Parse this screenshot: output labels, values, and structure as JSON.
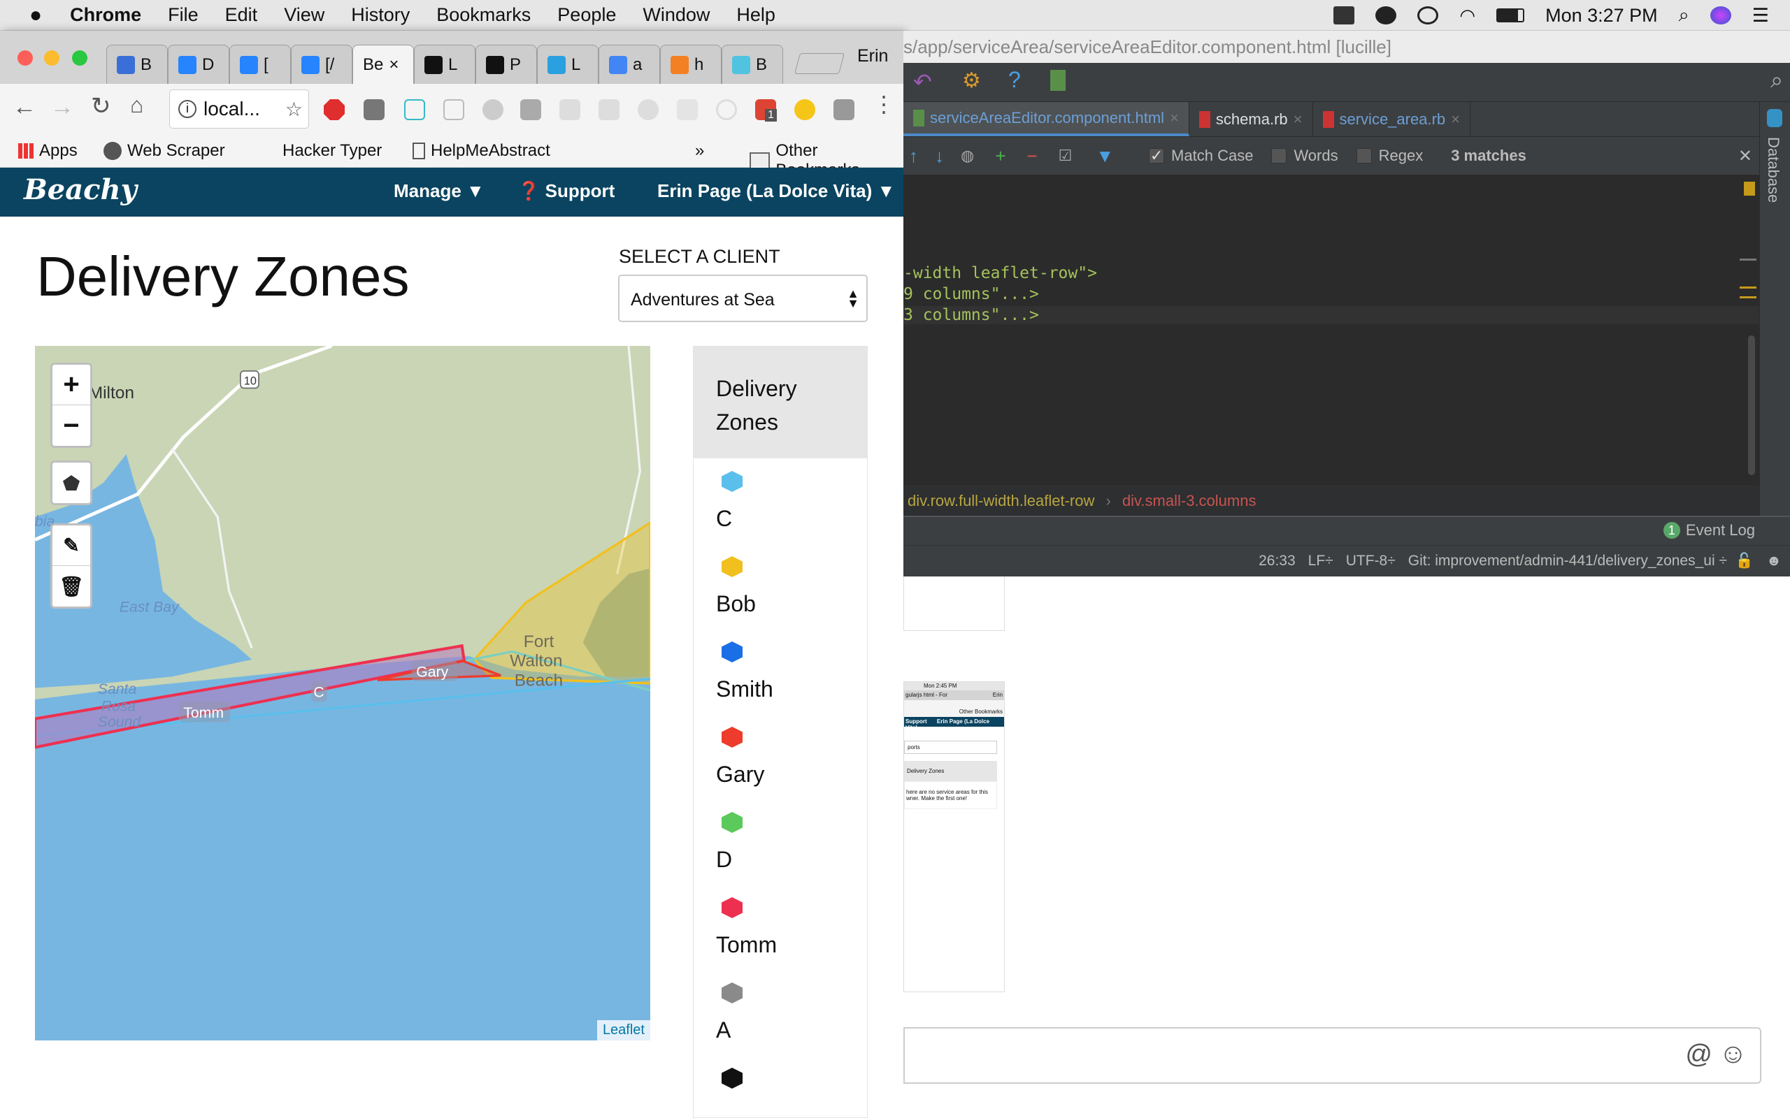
{
  "menubar": {
    "app": "Chrome",
    "items": [
      "File",
      "Edit",
      "View",
      "History",
      "Bookmarks",
      "People",
      "Window",
      "Help"
    ],
    "clock": "Mon 3:27 PM"
  },
  "chrome": {
    "tabs": [
      {
        "label": "B",
        "color": "#3a6fd8"
      },
      {
        "label": "D",
        "color": "#2684ff"
      },
      {
        "label": "[",
        "color": "#2684ff"
      },
      {
        "label": "[/",
        "color": "#2684ff"
      },
      {
        "label": "Be",
        "color": "#ffffff",
        "active": true
      },
      {
        "label": "L",
        "color": "#111111"
      },
      {
        "label": "P",
        "color": "#111111"
      },
      {
        "label": "L",
        "color": "#2aa0e0"
      },
      {
        "label": "a",
        "color": "#4285f4"
      },
      {
        "label": "h",
        "color": "#f48024"
      },
      {
        "label": "B",
        "color": "#4fc3e0"
      }
    ],
    "profile": "Erin",
    "omnibox": "local...",
    "bookmarks": {
      "apps": "Apps",
      "web_scraper": "Web Scraper",
      "hacker_typer": "Hacker Typer",
      "helpme": "HelpMeAbstract",
      "overflow": "»",
      "other": "Other Bookmarks"
    },
    "ext_badge": "1"
  },
  "site": {
    "logo": "Beachy",
    "manage": "Manage",
    "support": "Support",
    "user": "Erin Page (La Dolce Vita)",
    "title": "Delivery Zones",
    "select_label": "SELECT A CLIENT",
    "select_value": "Adventures at Sea",
    "map": {
      "places": {
        "milton": "Milton",
        "east_bay": "East Bay",
        "santa": "Santa",
        "rosa": "Rosa",
        "sound": "Sound",
        "fort": "Fort",
        "walton": "Walton",
        "beach": "Beach",
        "shield": "10",
        "bia": "bia"
      },
      "zone_labels": {
        "gary": "Gary",
        "c": "C",
        "tomm": "Tomm"
      },
      "zoom_in": "+",
      "zoom_out": "−",
      "attribution": "Leaflet"
    },
    "legend": {
      "header": "Delivery Zones",
      "items": [
        {
          "label": "C",
          "color": "#5bbfec"
        },
        {
          "label": "Bob",
          "color": "#f2c01e"
        },
        {
          "label": "Smith",
          "color": "#1a6fe6"
        },
        {
          "label": "Gary",
          "color": "#ee3b2c"
        },
        {
          "label": "D",
          "color": "#5bc95b"
        },
        {
          "label": "Tomm",
          "color": "#ee3050"
        },
        {
          "label": "A",
          "color": "#8a8a8a"
        },
        {
          "label": "",
          "color": "#111111"
        }
      ]
    }
  },
  "ide": {
    "title": "s/app/serviceArea/serviceAreaEditor.component.html [lucille]",
    "tabs": [
      {
        "label": "serviceAreaEditor.component.html",
        "active": true
      },
      {
        "label": "schema.rb"
      },
      {
        "label": "service_area.rb"
      }
    ],
    "find": {
      "match_case": "Match Case",
      "words": "Words",
      "regex": "Regex",
      "matches": "3 matches"
    },
    "code": [
      "-width leaflet-row\">",
      "9 columns\"...>",
      "3 columns\"...>"
    ],
    "crumbs": {
      "first": "div.row.full-width.leaflet-row",
      "sep": "›",
      "second": "div.small-3.columns"
    },
    "event_log": "Event Log",
    "event_count": "1",
    "status": {
      "pos": "26:33",
      "lf": "LF÷",
      "enc": "UTF-8÷",
      "git": "Git: improvement/admin-441/delivery_zones_ui ÷"
    },
    "side": "Database"
  },
  "thumbnail": {
    "clock": "Mon 2:45 PM",
    "tab1": "gularjs",
    "tab2": "html - For",
    "profile": "Erin",
    "other": "Other Bookmarks",
    "support": "Support",
    "user": "Erin Page (La Dolce Vita)",
    "select": "ports",
    "header": "Delivery Zones",
    "empty": "here are no service areas for this wner. Make the first one!"
  },
  "chat": {
    "at": "@",
    "emoji": "☺"
  }
}
